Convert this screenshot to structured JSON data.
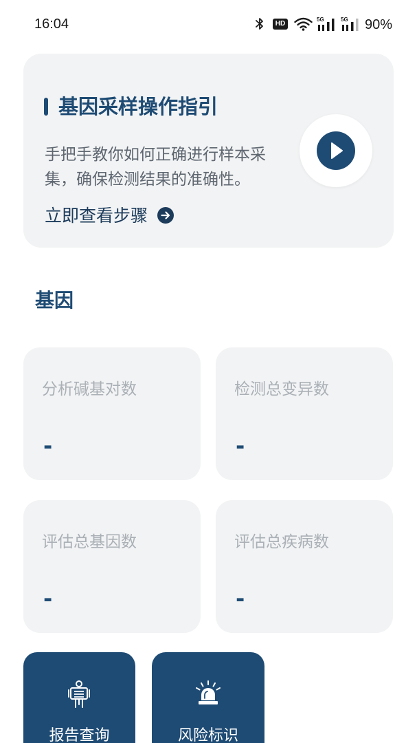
{
  "status_bar": {
    "time": "16:04",
    "hd_label": "HD",
    "network_1": "5G",
    "network_2": "5G",
    "battery": "90%",
    "icons": [
      "bluetooth-icon",
      "hd-icon",
      "wifi-icon",
      "signal-icon",
      "signal-icon"
    ]
  },
  "guide_card": {
    "title": "基因采样操作指引",
    "description": "手把手教你如何正确进行样本采集，确保检测结果的准确性。",
    "link_label": "立即查看步骤",
    "link_icon": "arrow-right-circle-icon",
    "play_icon": "play-icon"
  },
  "section": {
    "title": "基因"
  },
  "stats": [
    {
      "label": "分析碱基对数",
      "value": "-"
    },
    {
      "label": "检测总变异数",
      "value": "-"
    },
    {
      "label": "评估总基因数",
      "value": "-"
    },
    {
      "label": "评估总疾病数",
      "value": "-"
    }
  ],
  "shortcuts": [
    {
      "label": "报告查询",
      "icon": "body-scan-icon"
    },
    {
      "label": "风险标识",
      "icon": "alarm-icon"
    }
  ],
  "colors": {
    "primary": "#1e4b74",
    "card_background": "#f2f3f4",
    "description_text": "#5e6670",
    "label_text": "#aab0b6",
    "page_background": "#ffffff"
  }
}
